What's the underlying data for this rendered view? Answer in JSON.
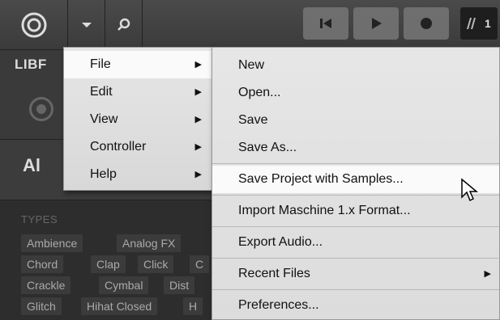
{
  "toolbar": {
    "icons": [
      "maschine-logo-icon",
      "dropdown-arrow-icon",
      "search-icon",
      "skip-back-icon",
      "play-icon",
      "record-icon",
      "ni-logo-icon"
    ],
    "counter": "1"
  },
  "library": {
    "title": "LIBF",
    "all_label": "Al",
    "types_label": "TYPES",
    "tags": [
      [
        "Ambience",
        "Analog FX",
        ""
      ],
      [
        "Chord",
        "Clap",
        "Click",
        "C"
      ],
      [
        "Crackle",
        "Cymbal",
        "Dist"
      ],
      [
        "Glitch",
        "Hihat Closed",
        "H"
      ]
    ]
  },
  "main_menu": {
    "items": [
      {
        "label": "File",
        "has_submenu": true,
        "highlighted": true
      },
      {
        "label": "Edit",
        "has_submenu": true
      },
      {
        "label": "View",
        "has_submenu": true
      },
      {
        "label": "Controller",
        "has_submenu": true
      },
      {
        "label": "Help",
        "has_submenu": true
      }
    ]
  },
  "file_menu": {
    "items": [
      {
        "label": "New"
      },
      {
        "label": "Open..."
      },
      {
        "label": "Save"
      },
      {
        "label": "Save As..."
      },
      {
        "label": "Save Project with Samples...",
        "highlighted": true
      },
      {
        "label": "Import Maschine 1.x Format..."
      },
      {
        "label": "Export Audio..."
      },
      {
        "label": "Recent Files",
        "has_submenu": true
      },
      {
        "label": "Preferences..."
      }
    ]
  },
  "colors": {
    "menu_bg": "#e0e0e0",
    "menu_highlight": "#fafafa",
    "panel_bg": "#2d2d2d",
    "tag_bg": "#3b3b3b"
  }
}
